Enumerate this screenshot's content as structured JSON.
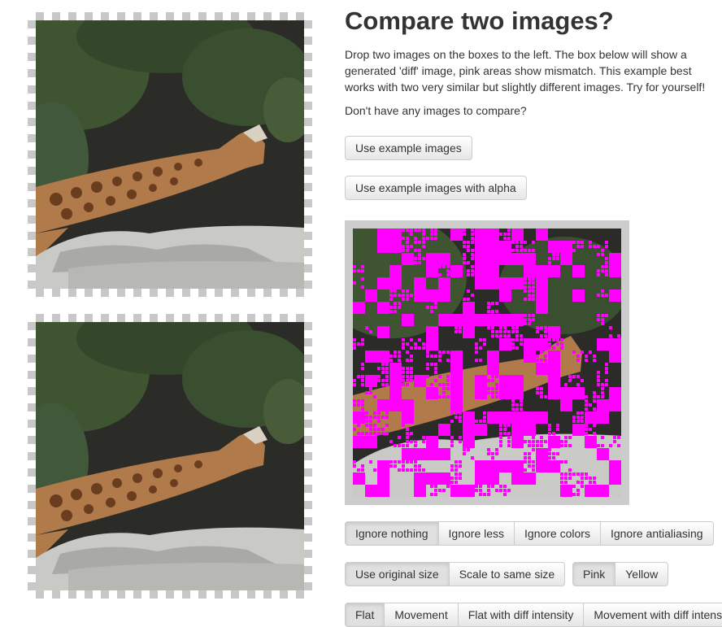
{
  "page": {
    "title": "Compare two images?",
    "intro": "Drop two images on the boxes to the left. The box below will show a generated 'diff' image, pink areas show mismatch. This example best works with two very similar but slightly different images. Try for yourself!",
    "question": "Don't have any images to compare?"
  },
  "buttons": {
    "example": "Use example images",
    "example_alpha": "Use example images with alpha"
  },
  "ignore_group": {
    "options": [
      "Ignore nothing",
      "Ignore less",
      "Ignore colors",
      "Ignore antialiasing"
    ],
    "selected": "Ignore nothing"
  },
  "size_group": {
    "options": [
      "Use original size",
      "Scale to same size"
    ],
    "selected": "Use original size"
  },
  "color_group": {
    "options": [
      "Pink",
      "Yellow"
    ],
    "selected": "Pink"
  },
  "render_group": {
    "options": [
      "Flat",
      "Movement",
      "Flat with diff intensity",
      "Movement with diff intensity"
    ],
    "selected": "Flat"
  },
  "images": {
    "image1": "giraffe-photo-1",
    "image2": "giraffe-photo-2",
    "diff": "diff-output"
  },
  "colors": {
    "diff_highlight": "#ff00ff",
    "box_checker": "#c8c8c8",
    "diff_frame": "#cccccc"
  }
}
